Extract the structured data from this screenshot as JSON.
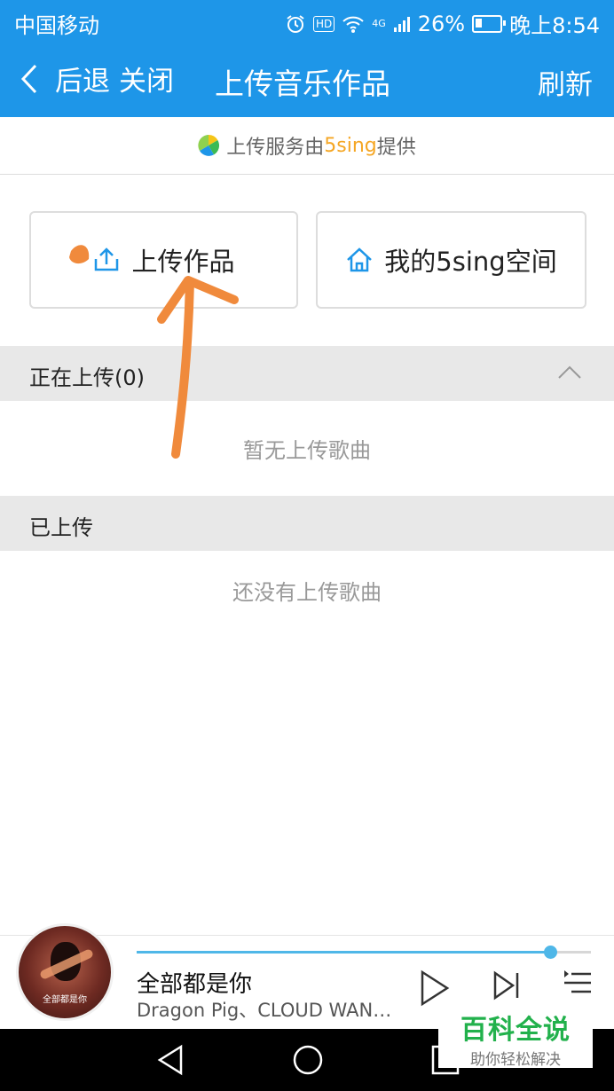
{
  "status_bar": {
    "carrier": "中国移动",
    "network": "4G",
    "hd_badge": "HD",
    "battery": "26%",
    "battery_level": 0.26,
    "time": "晚上8:54"
  },
  "nav": {
    "back_label": "后退",
    "close_label": "关闭",
    "title": "上传音乐作品",
    "refresh_label": "刷新"
  },
  "provider": {
    "prefix": "上传服务由",
    "brand": "5sing",
    "suffix": "提供"
  },
  "actions": {
    "upload_label": "上传作品",
    "space_label": "我的5sing空间"
  },
  "uploading": {
    "header": "正在上传(0)",
    "empty_text": "暂无上传歌曲"
  },
  "uploaded": {
    "header": "已上传",
    "empty_text": "还没有上传歌曲"
  },
  "player": {
    "song_title": "全部都是你",
    "artist": "Dragon Pig、CLOUD WAN…",
    "cover_text": "全部都是你",
    "progress": 0.91
  },
  "watermark": {
    "line1": "百科全说",
    "line2": "助你轻松解决"
  },
  "colors": {
    "primary": "#1e96e8",
    "brand_orange": "#f5a623",
    "annotation": "#f08a3c",
    "progress": "#4fb7e8"
  },
  "icons": [
    "back-chevron-icon",
    "alarm-icon",
    "wifi-icon",
    "signal-icon",
    "battery-icon",
    "5sing-logo-icon",
    "upload-icon",
    "home-icon",
    "chevron-up-icon",
    "play-icon",
    "next-icon",
    "playlist-icon",
    "nav-back-icon",
    "nav-home-icon",
    "nav-recent-icon"
  ]
}
